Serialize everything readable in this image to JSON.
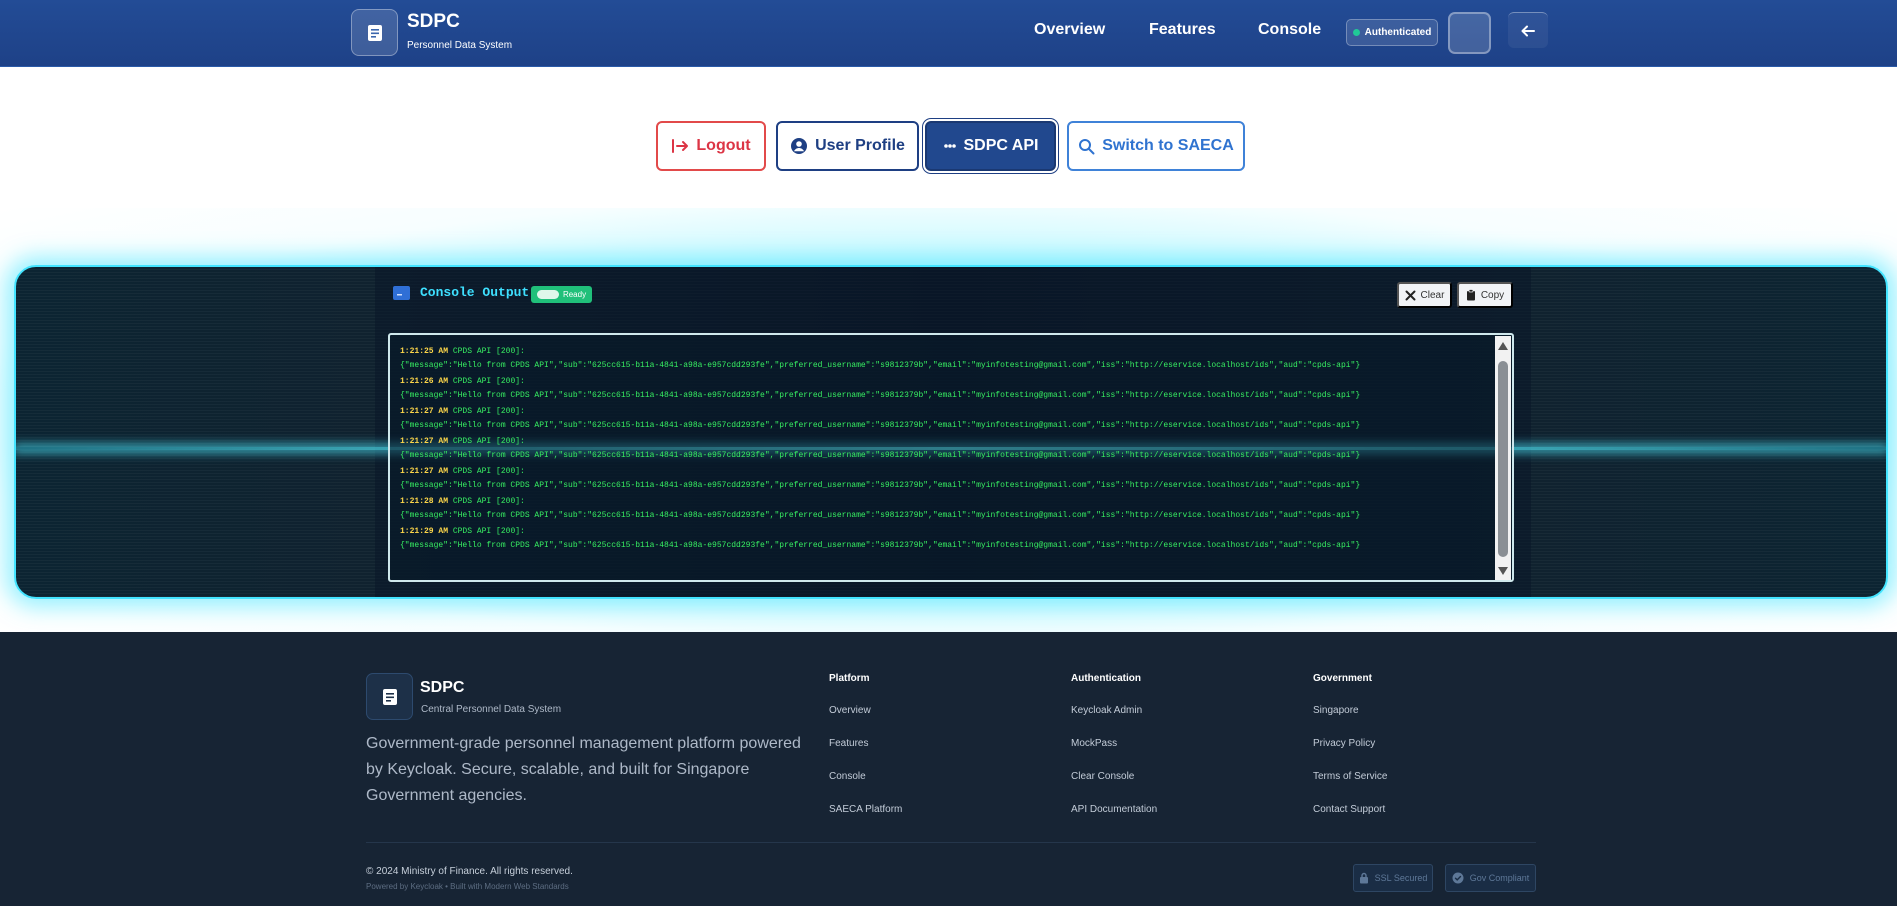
{
  "header": {
    "brand_title": "SDPC",
    "brand_subtitle": "Personnel Data System",
    "nav": [
      "Overview",
      "Features",
      "Console"
    ],
    "auth_status": "Authenticated"
  },
  "actions": {
    "logout": "Logout",
    "user_profile": "User Profile",
    "sdpc_api": "SDPC API",
    "switch_saeca": "Switch to SAECA"
  },
  "console": {
    "title": "Console Output",
    "status": "Ready",
    "clear_label": "Clear",
    "copy_label": "Copy",
    "entries": [
      {
        "time": "1:21:25 AM",
        "tag": "CPDS API [200]:",
        "body": "{\"message\":\"Hello from CPDS API\",\"sub\":\"625cc615-b11a-4841-a98a-e957cdd293fe\",\"preferred_username\":\"s9812379b\",\"email\":\"myinfotesting@gmail.com\",\"iss\":\"http://eservice.localhost/ids\",\"aud\":\"cpds-api\"}"
      },
      {
        "time": "1:21:26 AM",
        "tag": "CPDS API [200]:",
        "body": "{\"message\":\"Hello from CPDS API\",\"sub\":\"625cc615-b11a-4841-a98a-e957cdd293fe\",\"preferred_username\":\"s9812379b\",\"email\":\"myinfotesting@gmail.com\",\"iss\":\"http://eservice.localhost/ids\",\"aud\":\"cpds-api\"}"
      },
      {
        "time": "1:21:27 AM",
        "tag": "CPDS API [200]:",
        "body": "{\"message\":\"Hello from CPDS API\",\"sub\":\"625cc615-b11a-4841-a98a-e957cdd293fe\",\"preferred_username\":\"s9812379b\",\"email\":\"myinfotesting@gmail.com\",\"iss\":\"http://eservice.localhost/ids\",\"aud\":\"cpds-api\"}"
      },
      {
        "time": "1:21:27 AM",
        "tag": "CPDS API [200]:",
        "body": "{\"message\":\"Hello from CPDS API\",\"sub\":\"625cc615-b11a-4841-a98a-e957cdd293fe\",\"preferred_username\":\"s9812379b\",\"email\":\"myinfotesting@gmail.com\",\"iss\":\"http://eservice.localhost/ids\",\"aud\":\"cpds-api\"}"
      },
      {
        "time": "1:21:27 AM",
        "tag": "CPDS API [200]:",
        "body": "{\"message\":\"Hello from CPDS API\",\"sub\":\"625cc615-b11a-4841-a98a-e957cdd293fe\",\"preferred_username\":\"s9812379b\",\"email\":\"myinfotesting@gmail.com\",\"iss\":\"http://eservice.localhost/ids\",\"aud\":\"cpds-api\"}"
      },
      {
        "time": "1:21:28 AM",
        "tag": "CPDS API [200]:",
        "body": "{\"message\":\"Hello from CPDS API\",\"sub\":\"625cc615-b11a-4841-a98a-e957cdd293fe\",\"preferred_username\":\"s9812379b\",\"email\":\"myinfotesting@gmail.com\",\"iss\":\"http://eservice.localhost/ids\",\"aud\":\"cpds-api\"}"
      },
      {
        "time": "1:21:29 AM",
        "tag": "CPDS API [200]:",
        "body": "{\"message\":\"Hello from CPDS API\",\"sub\":\"625cc615-b11a-4841-a98a-e957cdd293fe\",\"preferred_username\":\"s9812379b\",\"email\":\"myinfotesting@gmail.com\",\"iss\":\"http://eservice.localhost/ids\",\"aud\":\"cpds-api\"}"
      }
    ]
  },
  "footer": {
    "brand_title": "SDPC",
    "brand_subtitle": "Central Personnel Data System",
    "description": "Government-grade personnel management platform powered by Keycloak. Secure, scalable, and built for Singapore Government agencies.",
    "columns": [
      {
        "title": "Platform",
        "links": [
          "Overview",
          "Features",
          "Console",
          "SAECA Platform"
        ]
      },
      {
        "title": "Authentication",
        "links": [
          "Keycloak Admin",
          "MockPass",
          "Clear Console",
          "API Documentation"
        ]
      },
      {
        "title": "Government",
        "links": [
          "Singapore",
          "Privacy Policy",
          "Terms of Service",
          "Contact Support"
        ]
      }
    ],
    "copyright": "© 2024 Ministry of Finance. All rights reserved.",
    "powered_by": "Powered by Keycloak • Built with Modern Web Standards",
    "badge_ssl": "SSL Secured",
    "badge_gov": "Gov Compliant"
  },
  "colors": {
    "header_bg": "#234c96",
    "accent_cyan": "#43e4ff",
    "logout_red": "#dc3545",
    "primary_blue": "#1e3f83",
    "saeca_blue": "#2f73d0",
    "log_time": "#ffd84a",
    "log_text": "#37ef62",
    "footer_bg": "#172434"
  },
  "icons": [
    "document-icon",
    "back-arrow-icon",
    "logout-icon",
    "user-circle-icon",
    "dots-icon",
    "search-icon",
    "console-icon",
    "close-icon",
    "clipboard-icon",
    "lock-icon",
    "check-badge-icon"
  ]
}
